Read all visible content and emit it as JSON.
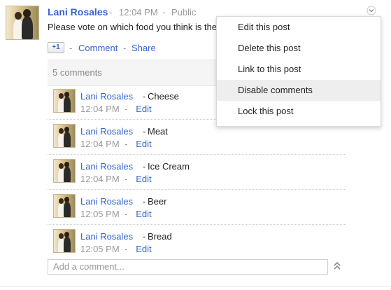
{
  "post": {
    "author": "Lani Rosales",
    "separator_1": "-",
    "time": "12:04 PM",
    "separator_2": "-",
    "visibility": "Public",
    "text": "Please vote on which food you think is the",
    "plusone_label": "+1",
    "comment_link": "Comment",
    "share_link": "Share",
    "dash": "-"
  },
  "comments_header": {
    "count_label": "5 comments"
  },
  "comments": [
    {
      "author": "Lani Rosales",
      "text": "Cheese",
      "time": "12:04 PM",
      "edit": "Edit"
    },
    {
      "author": "Lani Rosales",
      "text": "Meat",
      "time": "12:04 PM",
      "edit": "Edit"
    },
    {
      "author": "Lani Rosales",
      "text": "Ice Cream",
      "time": "12:04 PM",
      "edit": "Edit"
    },
    {
      "author": "Lani Rosales",
      "text": "Beer",
      "time": "12:05 PM",
      "edit": "Edit"
    },
    {
      "author": "Lani Rosales",
      "text": "Bread",
      "time": "12:05 PM",
      "edit": "Edit"
    }
  ],
  "menu": {
    "items": [
      {
        "label": "Edit this post"
      },
      {
        "label": "Delete this post"
      },
      {
        "label": "Link to this post"
      },
      {
        "label": "Disable comments",
        "highlighted": true
      },
      {
        "label": "Lock this post"
      }
    ]
  },
  "add_comment": {
    "placeholder": "Add a comment..."
  },
  "icons": {
    "dropdown": "chevron-down-icon",
    "collapse": "double-chevron-up-icon",
    "avatar": "avatar-photo"
  },
  "colors": {
    "link": "#3366cc",
    "muted": "#999999",
    "menu_highlight": "#eeeeee"
  }
}
